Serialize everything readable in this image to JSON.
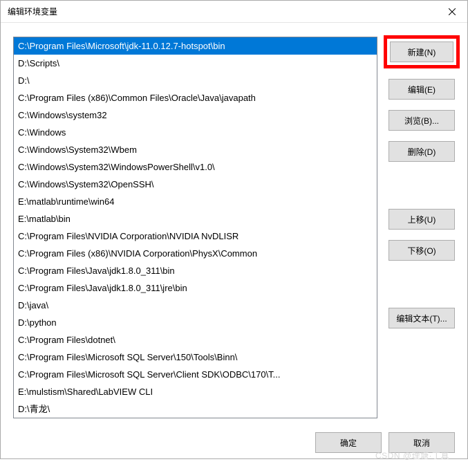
{
  "window": {
    "title": "编辑环境变量"
  },
  "list": {
    "items": [
      "C:\\Program Files\\Microsoft\\jdk-11.0.12.7-hotspot\\bin",
      "D:\\Scripts\\",
      "D:\\",
      "C:\\Program Files (x86)\\Common Files\\Oracle\\Java\\javapath",
      "C:\\Windows\\system32",
      "C:\\Windows",
      "C:\\Windows\\System32\\Wbem",
      "C:\\Windows\\System32\\WindowsPowerShell\\v1.0\\",
      "C:\\Windows\\System32\\OpenSSH\\",
      "E:\\matlab\\runtime\\win64",
      "E:\\matlab\\bin",
      "C:\\Program Files\\NVIDIA Corporation\\NVIDIA NvDLISR",
      "C:\\Program Files (x86)\\NVIDIA Corporation\\PhysX\\Common",
      "C:\\Program Files\\Java\\jdk1.8.0_311\\bin",
      "C:\\Program Files\\Java\\jdk1.8.0_311\\jre\\bin",
      "D:\\java\\",
      "D:\\python",
      "C:\\Program Files\\dotnet\\",
      "C:\\Program Files\\Microsoft SQL Server\\150\\Tools\\Binn\\",
      "C:\\Program Files\\Microsoft SQL Server\\Client SDK\\ODBC\\170\\T...",
      "E:\\mulstism\\Shared\\LabVIEW CLI",
      "D:\\青龙\\"
    ],
    "selectedIndex": 0
  },
  "buttons": {
    "new": "新建(N)",
    "edit": "编辑(E)",
    "browse": "浏览(B)...",
    "delete": "删除(D)",
    "moveUp": "上移(U)",
    "moveDown": "下移(O)",
    "editText": "编辑文本(T)...",
    "ok": "确定",
    "cancel": "取消"
  },
  "watermark": "CSDN @理塘·丁真"
}
